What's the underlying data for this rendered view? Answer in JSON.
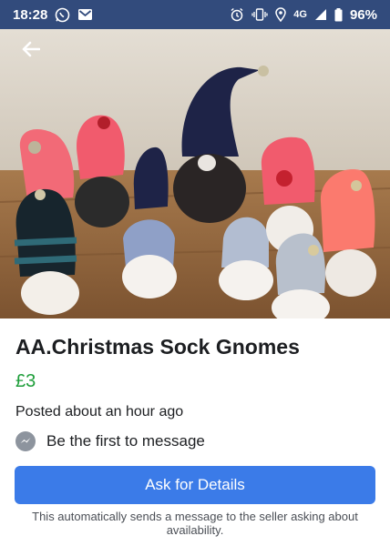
{
  "status_bar": {
    "time": "18:28",
    "network": "4G",
    "battery": "96%",
    "icons": [
      "whatsapp-icon",
      "gmail-icon",
      "alarm-icon",
      "vibrate-icon",
      "location-icon",
      "signal-icon",
      "battery-icon"
    ]
  },
  "header": {
    "back_icon": "back-arrow-icon"
  },
  "listing": {
    "title": "AA.Christmas Sock Gnomes",
    "price": "£3",
    "posted": "Posted about an hour ago",
    "message_prompt": "Be the first to message"
  },
  "actions": {
    "ask_label": "Ask for Details",
    "disclaimer": "This automatically sends a message to the seller asking about availability."
  },
  "colors": {
    "status_bar": "#324b7c",
    "price": "#1e9e3a",
    "button": "#3b7be8"
  }
}
